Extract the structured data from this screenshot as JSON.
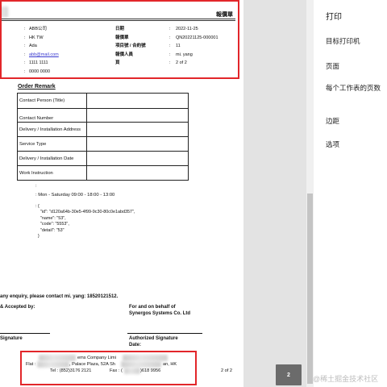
{
  "document": {
    "title": "報價單",
    "info_left": [
      "ABB公司",
      "HK TW",
      "Ada",
      "abb@mail.com",
      "1111 1111",
      "0000 0000"
    ],
    "info_labels": [
      "日期",
      "報價單",
      "項目號 / 合約號",
      "報價人員",
      "頁"
    ],
    "info_values": [
      "2022-11-25",
      "QN20221125-000001",
      "11",
      "mi. yang",
      "2 of 2"
    ],
    "order_remark_title": "Order Remark",
    "remark_rows": [
      {
        "label": "Contact Person (Title)",
        "value": ""
      },
      {
        "label": "Contact Number",
        "value": ""
      },
      {
        "label": "Delivery / Installation Address",
        "value": ""
      },
      {
        "label": "Service Type",
        "value": ""
      },
      {
        "label": "Delivery / Installation Date",
        "value": ""
      },
      {
        "label": "Work Instruction",
        "value": ""
      }
    ],
    "colon_mark": ":",
    "service_hours": ": Mon - Saturday 09:00 - 18:00 - 13:00",
    "json_block": ": {\n    \"id\": \"d120a64b-30e5-4f99-9c30-80c0e1abd357\",\n    \"name\": \"53\",\n    \"code\": \"5553\",\n    \"detail\": \"53\"\n  }",
    "enquiry_text": "any enquiry, please contact mi. yang: 18520121512.",
    "accepted_text": "& Accepted by:",
    "behalf_line1": "For and on behalf of",
    "behalf_line2": "Synergos Systems Co. Ltd",
    "signature_left": "Signature",
    "signature_right_line1": "Authorized Signature",
    "signature_right_line2": "Date:",
    "footer_company": "ems Company Limi",
    "footer_addr_a": "Flat :",
    "footer_addr_b": ", Palace Plaza, 52A Sh",
    "footer_addr_c": "an, HK",
    "footer_tel": "Tel : (852)3176 2121",
    "footer_fax_a": "Fax : (",
    "footer_fax_b": ")618 9956",
    "footer_page": "2 of 2"
  },
  "page_badge": "2",
  "print_panel": {
    "title": "打印",
    "items": [
      "目标打印机",
      "页面",
      "每个工作表的页数",
      "边距",
      "选项"
    ]
  },
  "watermark": "@稀土掘金技术社区",
  "colors": {
    "highlight_red": "#e2262a",
    "badge_gray": "#6b6b6b"
  }
}
